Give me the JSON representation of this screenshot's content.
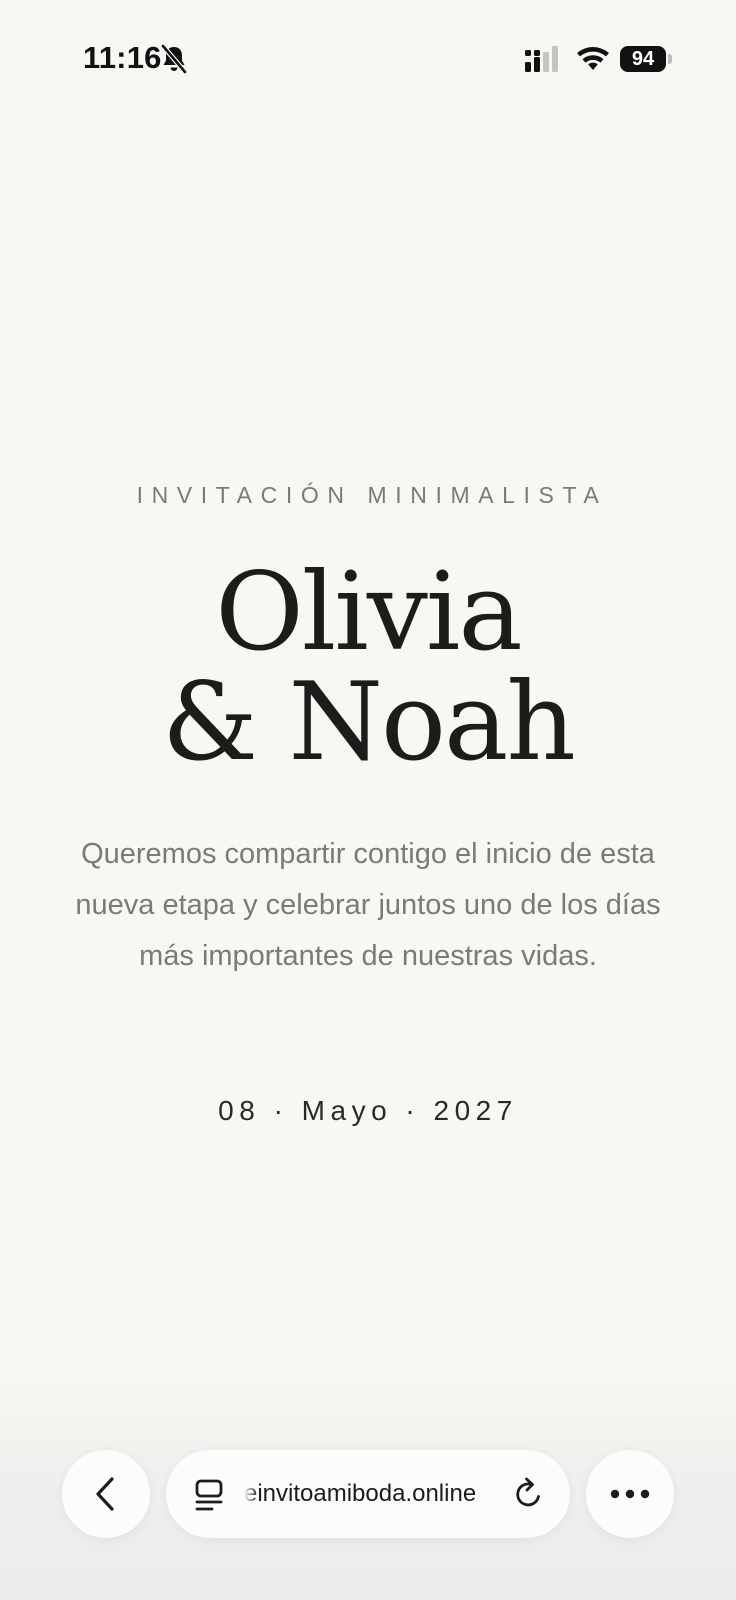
{
  "status_bar": {
    "time": "11:16",
    "battery_level": "94",
    "icons": [
      "bell-slash-icon",
      "cellular-signal-icon",
      "wifi-icon",
      "battery-icon"
    ]
  },
  "invitation": {
    "eyebrow": "INVITACIÓN MINIMALISTA",
    "name_line_1": "Olivia",
    "name_line_2": "& Noah",
    "description": "Queremos compartir contigo el inicio de esta nueva etapa y celebrar juntos uno de los días más importantes de nuestras vidas.",
    "date": "08 · Mayo · 2027"
  },
  "browser_toolbar": {
    "url": "einvitoamiboda.online",
    "icons": [
      "chevron-left-icon",
      "tabs-icon",
      "reload-icon",
      "more-icon"
    ]
  },
  "colors": {
    "background": "#f7f7f4",
    "heading": "#1c1c1a",
    "muted_text": "#7a7a76"
  }
}
